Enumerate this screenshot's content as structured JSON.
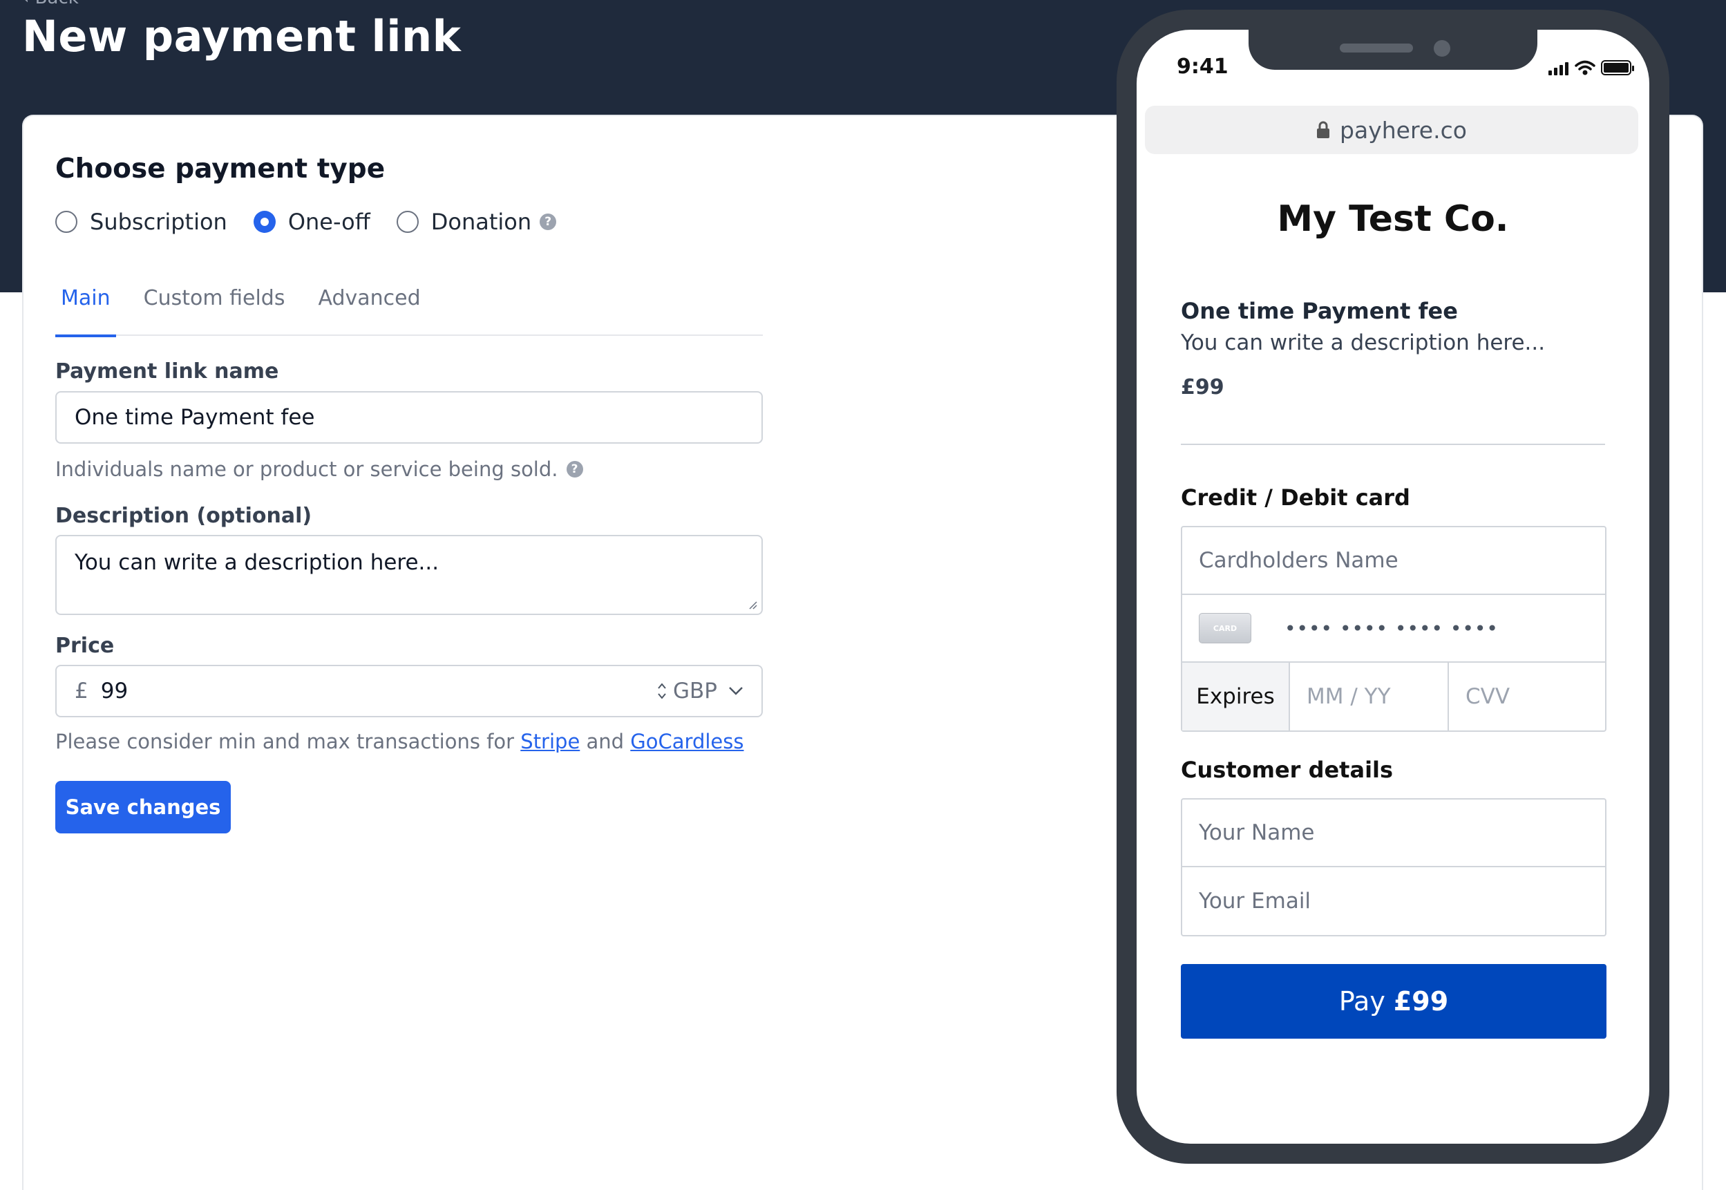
{
  "header": {
    "back_label": "Back",
    "title": "New payment link"
  },
  "form": {
    "section_title": "Choose payment type",
    "payment_types": [
      {
        "label": "Subscription",
        "selected": false
      },
      {
        "label": "One-off",
        "selected": true
      },
      {
        "label": "Donation",
        "selected": false
      }
    ],
    "tabs": [
      {
        "label": "Main",
        "active": true
      },
      {
        "label": "Custom fields",
        "active": false
      },
      {
        "label": "Advanced",
        "active": false
      }
    ],
    "name_label": "Payment link name",
    "name_value": "One time Payment fee",
    "name_hint": "Individuals name or product or service being sold.",
    "description_label": "Description (optional)",
    "description_value": "You can write a description here...",
    "price_label": "Price",
    "price_symbol": "£",
    "price_value": "99",
    "currency": "GBP",
    "price_hint_prefix": "Please consider min and max transactions for",
    "stripe_link": "Stripe",
    "price_hint_and": "and",
    "gocardless_link": "GoCardless",
    "save_label": "Save changes"
  },
  "preview": {
    "time": "9:41",
    "url": "payhere.co",
    "company": "My Test Co.",
    "product_name": "One time Payment fee",
    "product_description": "You can write a description here...",
    "product_price": "£99",
    "card_heading": "Credit / Debit card",
    "cardholder_placeholder": "Cardholders Name",
    "card_icon_text": "CARD",
    "card_number_placeholder": "•••• •••• •••• ••••",
    "expires_label": "Expires",
    "expiry_placeholder": "MM / YY",
    "cvv_placeholder": "CVV",
    "customer_heading": "Customer details",
    "name_placeholder": "Your Name",
    "email_placeholder": "Your Email",
    "pay_label": "Pay",
    "pay_amount": "£99"
  },
  "colors": {
    "header_bg": "#1f2a3c",
    "accent": "#2563eb",
    "pay_button": "#0047bb",
    "phone_frame": "#343a43"
  }
}
